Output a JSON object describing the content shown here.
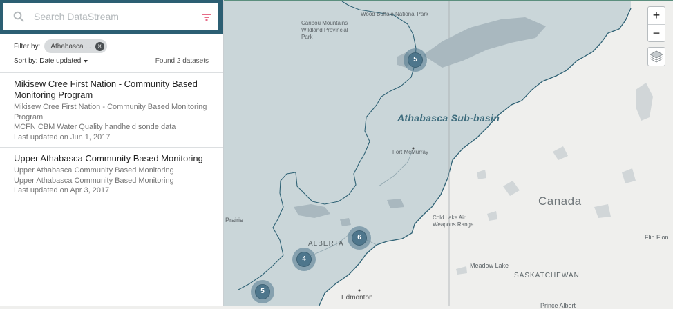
{
  "search": {
    "placeholder": "Search DataStream"
  },
  "filter": {
    "label": "Filter by:",
    "chip_label": "Athabasca ..."
  },
  "sort": {
    "label": "Sort by: Date updated"
  },
  "found_text": "Found 2 datasets",
  "results": [
    {
      "title": "Mikisew Cree First Nation - Community Based Monitoring Program",
      "org": "Mikisew Cree First Nation - Community Based Monitoring Program",
      "description": "MCFN CBM Water Quality handheld sonde data",
      "updated": "Last updated on Jun 1, 2017"
    },
    {
      "title": "Upper Athabasca Community Based Monitoring",
      "org": "Upper Athabasca Community Based Monitoring",
      "description": "Upper Athabasca Community Based Monitoring",
      "updated": "Last updated on Apr 3, 2017"
    }
  ],
  "map": {
    "basin_label": "Athabasca Sub-basin",
    "country_label": "Canada",
    "places": {
      "wood_buffalo": "Wood Buffalo National Park",
      "caribou": "Caribou Mountains Wildland Provincial Park",
      "fort_mcmurray": "Fort McMurray",
      "cold_lake": "Cold Lake Air Weapons Range",
      "alberta": "ALBERTA",
      "saskatchewan": "SASKATCHEWAN",
      "meadow_lake": "Meadow Lake",
      "edmonton": "Edmonton",
      "prairie": "Prairie",
      "flin_flon": "Flin Flon",
      "prince_albert": "Prince Albert"
    },
    "clusters": [
      {
        "id": "north",
        "count": "5"
      },
      {
        "id": "east",
        "count": "6"
      },
      {
        "id": "central",
        "count": "4"
      },
      {
        "id": "south",
        "count": "5"
      }
    ],
    "zoom_in": "+",
    "zoom_out": "−",
    "colors": {
      "basin_fill": "#cad6d9",
      "basin_stroke": "#2f6275",
      "land": "#efefed",
      "water": "#c3ccd0",
      "cluster": "#4e768c",
      "accent": "#2c5f73",
      "filter_icon": "#e1476b"
    }
  }
}
